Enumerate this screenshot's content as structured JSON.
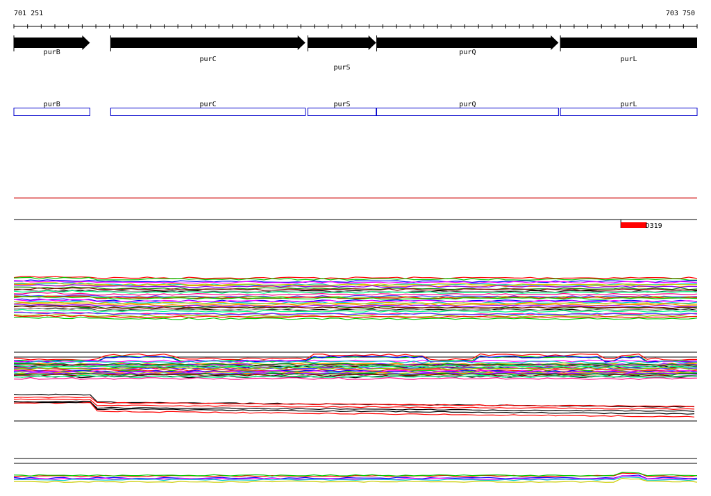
{
  "ruler": {
    "start_label": "701 251",
    "end_label": "703 750"
  },
  "genes": [
    {
      "name": "purB",
      "start": 701251,
      "end": 701529
    },
    {
      "name": "purC",
      "start": 701605,
      "end": 702317
    },
    {
      "name": "purS",
      "start": 702326,
      "end": 702576
    },
    {
      "name": "purQ",
      "start": 702578,
      "end": 703243
    },
    {
      "name": "purL",
      "start": 703250,
      "end": 703750
    }
  ],
  "feature": {
    "label": "D319",
    "start": 703471,
    "end": 703566
  },
  "colors": {
    "gene_arrow": "#000000",
    "annotation_box": "#0000cc",
    "feature_bar": "#ff0000",
    "divider_red": "#cc0000",
    "divider_black": "#000000"
  },
  "icons": [
    "gene-arrow-icon",
    "feature-marker-icon"
  ]
}
